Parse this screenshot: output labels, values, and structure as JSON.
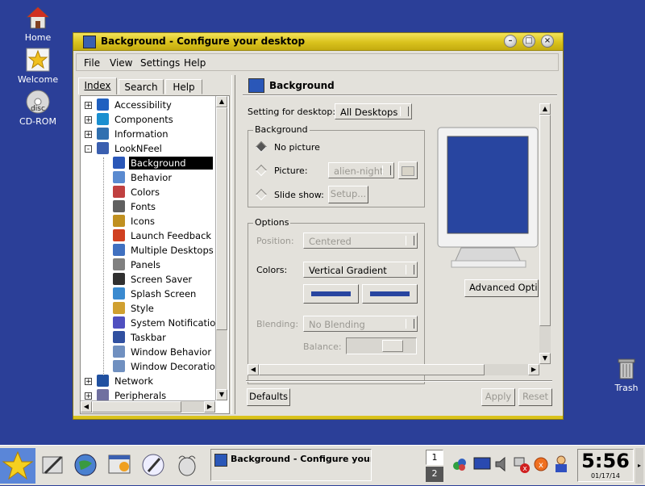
{
  "desktop": {
    "icons": [
      {
        "label": "Home",
        "icon": "home-icon"
      },
      {
        "label": "Welcome",
        "icon": "star-icon"
      },
      {
        "label": "CD-ROM",
        "icon": "cdrom-icon"
      },
      {
        "label": "Trash",
        "icon": "trash-icon"
      }
    ],
    "cd_disc_text": "disc"
  },
  "window": {
    "title": "Background - Configure your desktop",
    "menu": [
      "File",
      "View",
      "Settings",
      "Help"
    ],
    "tabs": [
      "Index",
      "Search",
      "Help"
    ],
    "tree": [
      {
        "label": "Accessibility",
        "level": 0,
        "expander": "+",
        "color": "#2060c0"
      },
      {
        "label": "Components",
        "level": 0,
        "expander": "+",
        "color": "#1a8fd0"
      },
      {
        "label": "Information",
        "level": 0,
        "expander": "+",
        "color": "#3070b0"
      },
      {
        "label": "LookNFeel",
        "level": 0,
        "expander": "-",
        "color": "#3a5fb0"
      },
      {
        "label": "Background",
        "level": 1,
        "selected": true,
        "color": "#2a57b8"
      },
      {
        "label": "Behavior",
        "level": 1,
        "color": "#5a8ad0"
      },
      {
        "label": "Colors",
        "level": 1,
        "color": "#c04040"
      },
      {
        "label": "Fonts",
        "level": 1,
        "color": "#606060"
      },
      {
        "label": "Icons",
        "level": 1,
        "color": "#c09020"
      },
      {
        "label": "Launch Feedback",
        "level": 1,
        "color": "#d04020"
      },
      {
        "label": "Multiple Desktops",
        "level": 1,
        "color": "#4070c0"
      },
      {
        "label": "Panels",
        "level": 1,
        "color": "#808080"
      },
      {
        "label": "Screen Saver",
        "level": 1,
        "color": "#303030"
      },
      {
        "label": "Splash Screen",
        "level": 1,
        "color": "#3a8ad0"
      },
      {
        "label": "Style",
        "level": 1,
        "color": "#d0a030"
      },
      {
        "label": "System Notifications",
        "level": 1,
        "color": "#5050c0"
      },
      {
        "label": "Taskbar",
        "level": 1,
        "color": "#3050a0"
      },
      {
        "label": "Window Behavior",
        "level": 1,
        "color": "#7090c0"
      },
      {
        "label": "Window Decoration",
        "level": 1,
        "color": "#7090c0"
      },
      {
        "label": "Network",
        "level": 0,
        "expander": "+",
        "color": "#2050a0"
      },
      {
        "label": "Peripherals",
        "level": 0,
        "expander": "+",
        "color": "#7070a0"
      }
    ],
    "module_title": "Background",
    "setting_for_label": "Setting for desktop:",
    "setting_for_value": "All Desktops",
    "background_group": "Background",
    "radio_no_picture": "No picture",
    "radio_picture": "Picture:",
    "picture_value": "alien-night",
    "radio_slideshow": "Slide show:",
    "setup_label": "Setup...",
    "options_group": "Options",
    "position_label": "Position:",
    "position_value": "Centered",
    "colors_label": "Colors:",
    "colors_value": "Vertical Gradient",
    "color1": "#2845a0",
    "color2": "#2845a0",
    "blending_label": "Blending:",
    "blending_value": "No Blending",
    "balance_label": "Balance:",
    "advanced_label": "Advanced Options",
    "defaults_label": "Defaults",
    "apply_label": "Apply",
    "reset_label": "Reset"
  },
  "taskbar": {
    "task_label": "Background - Configure your d",
    "desktop_pager": [
      "1",
      "2"
    ],
    "clock_time": "5:56",
    "clock_date": "01/17/14"
  }
}
